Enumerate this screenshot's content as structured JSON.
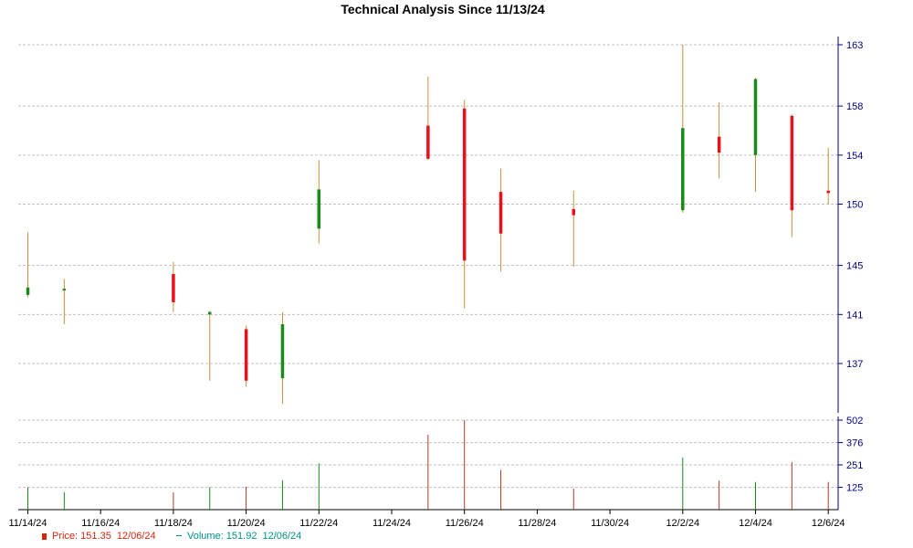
{
  "chart_data": {
    "type": "candlestick",
    "title": "Technical Analysis Since 11/13/24",
    "x_tick_labels": [
      "11/14/24",
      "11/16/24",
      "11/18/24",
      "11/20/24",
      "11/22/24",
      "11/24/24",
      "11/26/24",
      "11/28/24",
      "11/30/24",
      "12/2/24",
      "12/4/24",
      "12/6/24"
    ],
    "price_axis": {
      "ticks": [
        "137",
        "141",
        "145",
        "150",
        "154",
        "158",
        "163"
      ],
      "ylim": [
        133.5,
        163
      ]
    },
    "volume_axis": {
      "ticks": [
        "125",
        "251",
        "376",
        "502"
      ],
      "ylim": [
        0,
        502
      ]
    },
    "candles": [
      {
        "date": "11/14/24",
        "open": 142.6,
        "high": 147.7,
        "low": 142.4,
        "close": 143.2,
        "volume": 125
      },
      {
        "date": "11/15/24",
        "open": 143.0,
        "high": 143.9,
        "low": 140.2,
        "close": 143.1,
        "volume": 98
      },
      {
        "date": "11/18/24",
        "open": 144.3,
        "high": 145.3,
        "low": 141.2,
        "close": 142.0,
        "volume": 97
      },
      {
        "date": "11/19/24",
        "open": 141.0,
        "high": 141.3,
        "low": 135.6,
        "close": 141.2,
        "volume": 127
      },
      {
        "date": "11/20/24",
        "open": 139.8,
        "high": 140.1,
        "low": 135.1,
        "close": 135.6,
        "volume": 129
      },
      {
        "date": "11/21/24",
        "open": 135.8,
        "high": 141.2,
        "low": 133.7,
        "close": 140.2,
        "volume": 165
      },
      {
        "date": "11/22/24",
        "open": 148.0,
        "high": 153.6,
        "low": 146.8,
        "close": 151.2,
        "volume": 260
      },
      {
        "date": "11/25/24",
        "open": 156.4,
        "high": 160.4,
        "low": 153.6,
        "close": 153.7,
        "volume": 420
      },
      {
        "date": "11/26/24",
        "open": 157.8,
        "high": 158.5,
        "low": 141.5,
        "close": 145.4,
        "volume": 502
      },
      {
        "date": "11/27/24",
        "open": 151.0,
        "high": 152.9,
        "low": 144.5,
        "close": 147.6,
        "volume": 222
      },
      {
        "date": "11/29/24",
        "open": 149.6,
        "high": 151.1,
        "low": 144.9,
        "close": 149.1,
        "volume": 118
      },
      {
        "date": "12/2/24",
        "open": 149.5,
        "high": 163.0,
        "low": 149.3,
        "close": 156.2,
        "volume": 292
      },
      {
        "date": "12/3/24",
        "open": 155.5,
        "high": 158.3,
        "low": 152.1,
        "close": 154.2,
        "volume": 163
      },
      {
        "date": "12/4/24",
        "open": 154.0,
        "high": 160.3,
        "low": 151.0,
        "close": 160.2,
        "volume": 155
      },
      {
        "date": "12/5/24",
        "open": 157.2,
        "high": 157.3,
        "low": 147.3,
        "close": 149.5,
        "volume": 266
      },
      {
        "date": "12/6/24",
        "open": 151.1,
        "high": 154.6,
        "low": 150.0,
        "close": 150.9,
        "volume": 155
      }
    ]
  },
  "legend": {
    "price_label": "Price: 151.35",
    "price_date": "12/06/24",
    "volume_label": "Volume: 151.92",
    "volume_date": "12/06/24"
  },
  "colors": {
    "up": "#1a8a1a",
    "down": "#e8121b",
    "wick": "#c89040",
    "volume": "#b03828",
    "axis": "#000080",
    "grid": "#c0c0c0"
  }
}
